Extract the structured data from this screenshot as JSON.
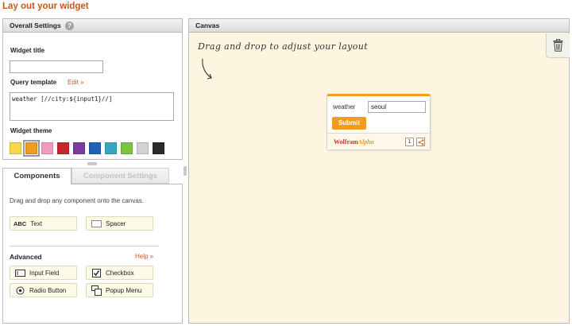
{
  "page": {
    "title": "Lay out your widget"
  },
  "settings": {
    "header": "Overall Settings",
    "help_glyph": "?",
    "widget_title_label": "Widget title",
    "widget_title_value": "",
    "query_template_label": "Query template",
    "edit_link": "Edit »",
    "query_template_value": "weather [//city:${input1}//]",
    "theme_label": "Widget theme",
    "themes": [
      {
        "name": "yellow",
        "color": "#f7d64a"
      },
      {
        "name": "orange",
        "color": "#f29c1d",
        "selected": true
      },
      {
        "name": "pink",
        "color": "#f39ac3"
      },
      {
        "name": "red",
        "color": "#c9252c"
      },
      {
        "name": "purple",
        "color": "#7c3a9e"
      },
      {
        "name": "blue",
        "color": "#1f63b8"
      },
      {
        "name": "teal",
        "color": "#35a7c1"
      },
      {
        "name": "green",
        "color": "#7ec43c"
      },
      {
        "name": "light-gray",
        "color": "#d3d3d3"
      },
      {
        "name": "black",
        "color": "#2b2b2b"
      }
    ]
  },
  "tabs": {
    "components": "Components",
    "component_settings": "Component Settings"
  },
  "components": {
    "hint": "Drag and drop any component onto the canvas.",
    "text_icon": "ABC",
    "text": "Text",
    "spacer": "Spacer",
    "advanced_label": "Advanced",
    "help_link": "Help »",
    "input_field": "Input Field",
    "checkbox": "Checkbox",
    "radio_button": "Radio Button",
    "popup_menu": "Popup Menu"
  },
  "canvas": {
    "header": "Canvas",
    "hint": "Drag and drop to adjust your layout"
  },
  "widget": {
    "field_label": "weather",
    "field_value": "seoul",
    "submit_label": "Submit",
    "brand_wolfram": "Wolfram",
    "brand_alpha": "Alpha",
    "badge_number": "1"
  },
  "colors": {
    "accent": "#c5591a",
    "widget_orange": "#f29c1d",
    "canvas_bg": "#fdf5df"
  }
}
